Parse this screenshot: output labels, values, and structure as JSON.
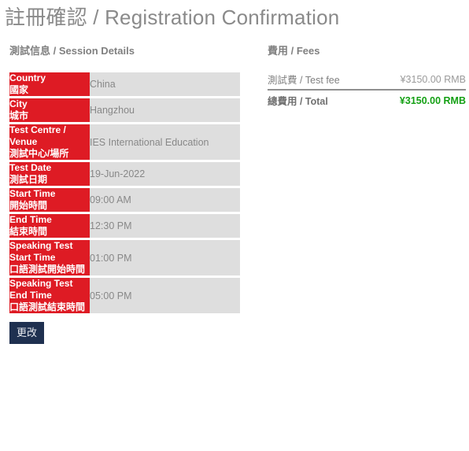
{
  "page": {
    "title": "註冊確認 / Registration Confirmation"
  },
  "session": {
    "heading": "測試信息 / Session Details",
    "rows": [
      {
        "label_en": "Country",
        "label_cjk": "國家",
        "value": "China"
      },
      {
        "label_en": "City",
        "label_cjk": "城市",
        "value": "Hangzhou"
      },
      {
        "label_en": "Test Centre / Venue",
        "label_cjk": "測試中心/場所",
        "value": "IES International Education"
      },
      {
        "label_en": "Test Date",
        "label_cjk": "測試日期",
        "value": "19-Jun-2022"
      },
      {
        "label_en": "Start Time",
        "label_cjk": "開始時間",
        "value": "09:00 AM"
      },
      {
        "label_en": "End Time",
        "label_cjk": "結束時間",
        "value": "12:30 PM"
      },
      {
        "label_en": "Speaking Test Start Time",
        "label_cjk": "口語測試開始時間",
        "value": "01:00 PM"
      },
      {
        "label_en": "Speaking Test End Time",
        "label_cjk": "口語測試結束時間",
        "value": "05:00 PM"
      }
    ],
    "change_button": "更改"
  },
  "fees": {
    "heading": "費用 / Fees",
    "rows": [
      {
        "name": "測試費 / Test fee",
        "amount": "¥3150.00 RMB"
      }
    ],
    "total": {
      "name": "總費用 / Total",
      "amount": "¥3150.00 RMB"
    }
  },
  "colors": {
    "label_red": "#de1b24",
    "value_gray": "#dedede",
    "total_green": "#14a014",
    "button_navy": "#1f3050",
    "title_gray": "#8a8a8a"
  }
}
